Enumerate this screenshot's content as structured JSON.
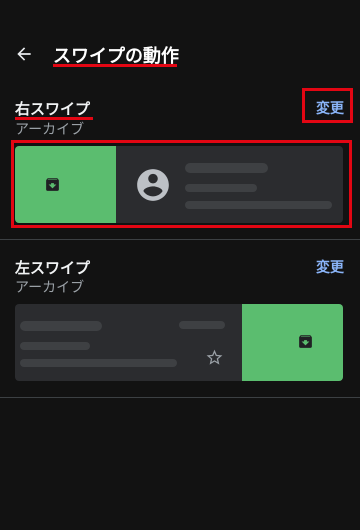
{
  "header": {
    "title": "スワイプの動作",
    "back_icon": "arrow-back-icon"
  },
  "right_swipe": {
    "title": "右スワイプ",
    "action": "アーカイブ",
    "change_label": "変更",
    "action_icon": "archive-icon",
    "avatar_icon": "account-circle-icon"
  },
  "left_swipe": {
    "title": "左スワイプ",
    "action": "アーカイブ",
    "change_label": "変更",
    "action_icon": "archive-icon",
    "star_icon": "star-outline-icon"
  },
  "colors": {
    "background": "#121212",
    "swipe_action": "#5bbd6f",
    "accent": "#8ab4f8",
    "highlight": "#e30613"
  }
}
